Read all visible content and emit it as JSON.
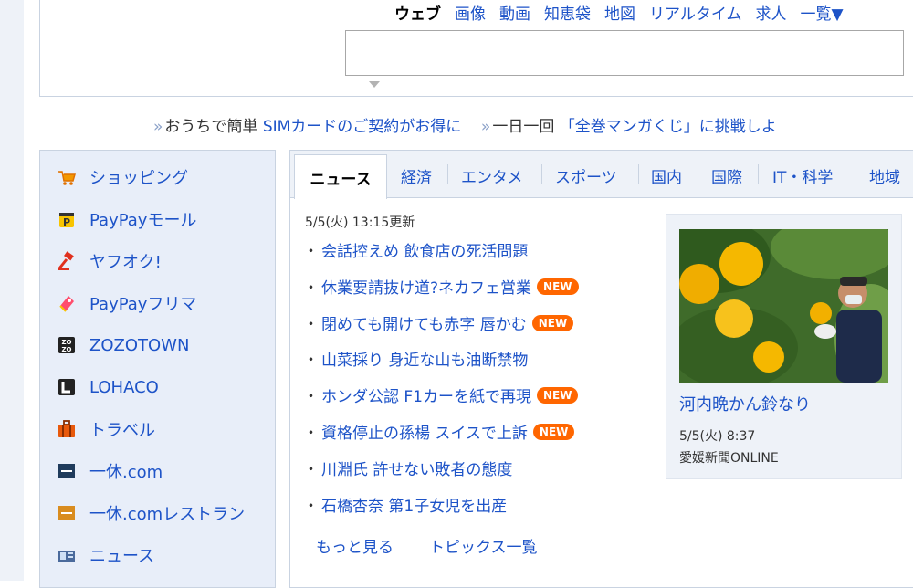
{
  "search": {
    "tabs": [
      {
        "label": "ウェブ",
        "active": true
      },
      {
        "label": "画像"
      },
      {
        "label": "動画"
      },
      {
        "label": "知恵袋"
      },
      {
        "label": "地図"
      },
      {
        "label": "リアルタイム"
      },
      {
        "label": "求人"
      },
      {
        "label": "一覧▼"
      }
    ],
    "query": ""
  },
  "promo": {
    "chevron": "»",
    "item1_prefix": "おうちで簡単",
    "item1_link": "SIMカードのご契約がお得に",
    "item2_prefix": "一日一回",
    "item2_link": "「全巻マンガくじ」に挑戦しよ"
  },
  "sidebar": {
    "items": [
      {
        "label": "ショッピング",
        "icon": "shopping-cart-icon"
      },
      {
        "label": "PayPayモール",
        "icon": "paypay-mall-icon"
      },
      {
        "label": "ヤフオク!",
        "icon": "auction-hammer-icon"
      },
      {
        "label": "PayPayフリマ",
        "icon": "paypay-fleamarket-icon"
      },
      {
        "label": "ZOZOTOWN",
        "icon": "zozotown-icon"
      },
      {
        "label": "LOHACO",
        "icon": "lohaco-icon"
      },
      {
        "label": "トラベル",
        "icon": "suitcase-icon"
      },
      {
        "label": "一休.com",
        "icon": "ikyu-icon"
      },
      {
        "label": "一休.comレストラン",
        "icon": "ikyu-restaurant-icon"
      },
      {
        "label": "ニュース",
        "icon": "news-icon"
      }
    ]
  },
  "news": {
    "tabs": [
      "ニュース",
      "経済",
      "エンタメ",
      "スポーツ",
      "国内",
      "国際",
      "IT・科学",
      "地域"
    ],
    "updated": "5/5(火) 13:15更新",
    "new_label": "NEW",
    "bullet": "・",
    "headlines": [
      {
        "text": "会話控えめ 飲食店の死活問題",
        "is_new": false
      },
      {
        "text": "休業要請抜け道?ネカフェ営業",
        "is_new": true
      },
      {
        "text": "閉めても開けても赤字 唇かむ",
        "is_new": true
      },
      {
        "text": "山菜採り 身近な山も油断禁物",
        "is_new": false
      },
      {
        "text": "ホンダ公認 F1カーを紙で再現",
        "is_new": true
      },
      {
        "text": "資格停止の孫楊 スイスで上訴",
        "is_new": true
      },
      {
        "text": "川淵氏 許せない敗者の態度",
        "is_new": false
      },
      {
        "text": "石橋杏奈 第1子女児を出産",
        "is_new": false
      }
    ],
    "more_label": "もっと見る",
    "topics_label": "トピックス一覧",
    "feature": {
      "title": "河内晩かん鈴なり",
      "date": "5/5(火) 8:37",
      "source": "愛媛新聞ONLINE"
    }
  },
  "colors": {
    "link": "#1d53c8",
    "new_badge": "#ff6600",
    "sidebar_bg": "#e8eef9",
    "border": "#c9d3e1"
  }
}
